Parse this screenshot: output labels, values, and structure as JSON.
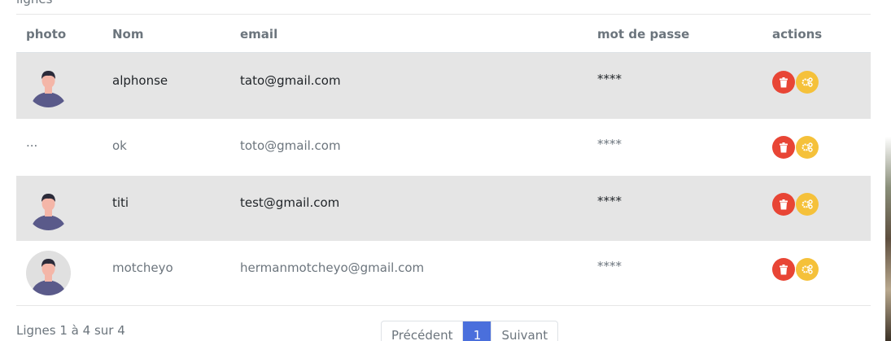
{
  "caption": "lignes",
  "columns": {
    "photo": "photo",
    "nom": "Nom",
    "email": "email",
    "password": "mot de passe",
    "actions": "actions"
  },
  "rows": [
    {
      "photo": "avatar",
      "nom": "alphonse",
      "email": "tato@gmail.com",
      "password": "****"
    },
    {
      "photo": "...",
      "nom": "ok",
      "email": "toto@gmail.com",
      "password": "****"
    },
    {
      "photo": "avatar",
      "nom": "titi",
      "email": "test@gmail.com",
      "password": "****"
    },
    {
      "photo": "avatar",
      "nom": "motcheyo",
      "email": "hermanmotcheyo@gmail.com",
      "password": "****"
    }
  ],
  "icons": {
    "delete": "trash-icon",
    "edit": "cogs-icon"
  },
  "colors": {
    "delete": "#e84535",
    "edit": "#f5c13a",
    "active_page": "#4a6fdc",
    "row_shade": "#e5e5e5"
  },
  "footer": {
    "info": "Lignes 1 à 4 sur 4",
    "prev": "Précédent",
    "page": "1",
    "next": "Suivant"
  }
}
